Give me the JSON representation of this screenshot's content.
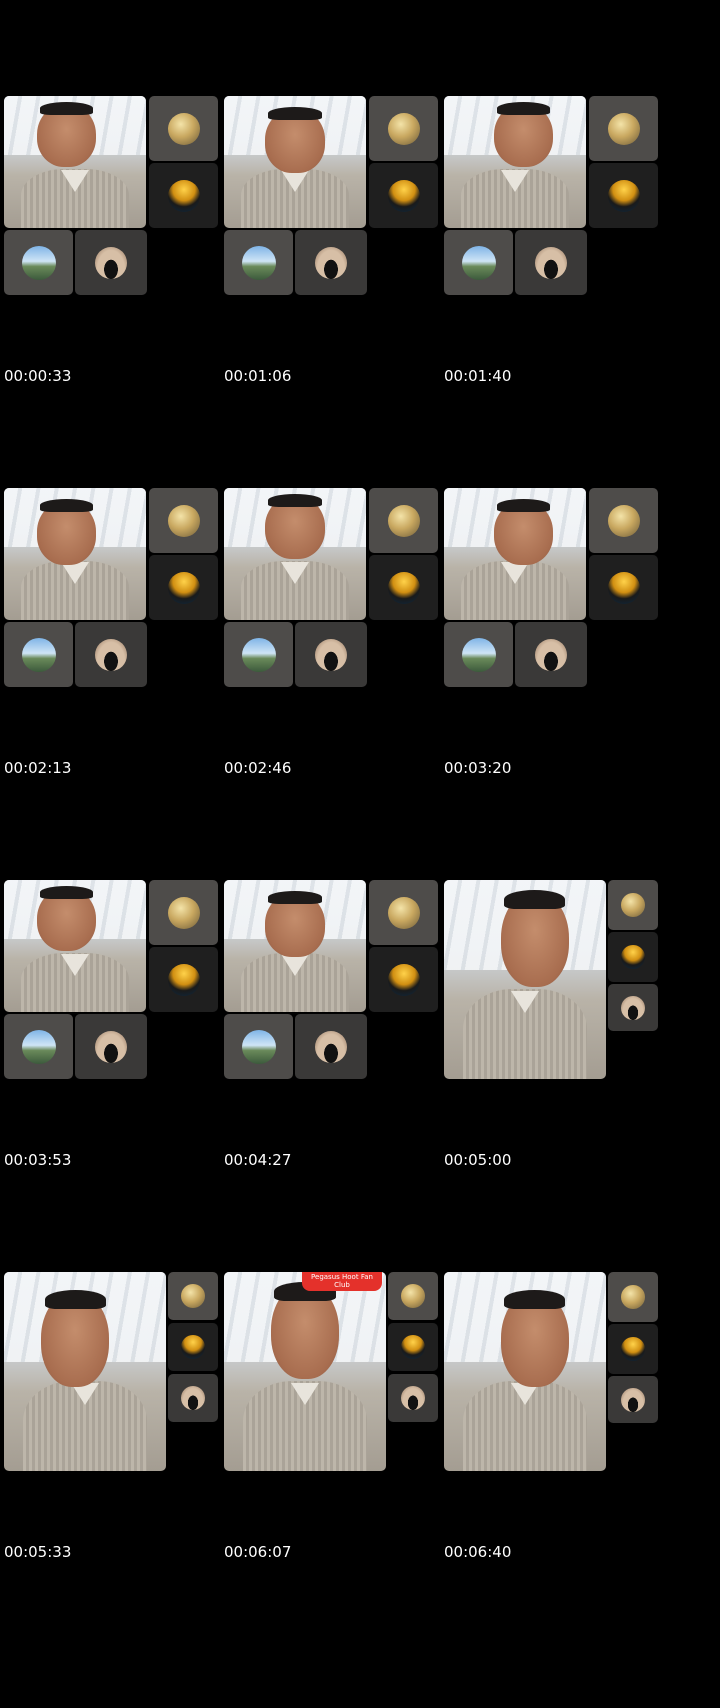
{
  "frames": [
    {
      "timestamp": "00:00:33"
    },
    {
      "timestamp": "00:01:06"
    },
    {
      "timestamp": "00:01:40"
    },
    {
      "timestamp": "00:02:13"
    },
    {
      "timestamp": "00:02:46"
    },
    {
      "timestamp": "00:03:20"
    },
    {
      "timestamp": "00:03:53"
    },
    {
      "timestamp": "00:04:27"
    },
    {
      "timestamp": "00:05:00"
    },
    {
      "timestamp": "00:05:33"
    },
    {
      "timestamp": "00:06:07",
      "banner": "Pegasus Hoot Fan Club"
    },
    {
      "timestamp": "00:06:40"
    }
  ],
  "participant_avatars": [
    "skull-avatar",
    "gold-bot-avatar",
    "landscape-avatar",
    "portrait-avatar"
  ]
}
